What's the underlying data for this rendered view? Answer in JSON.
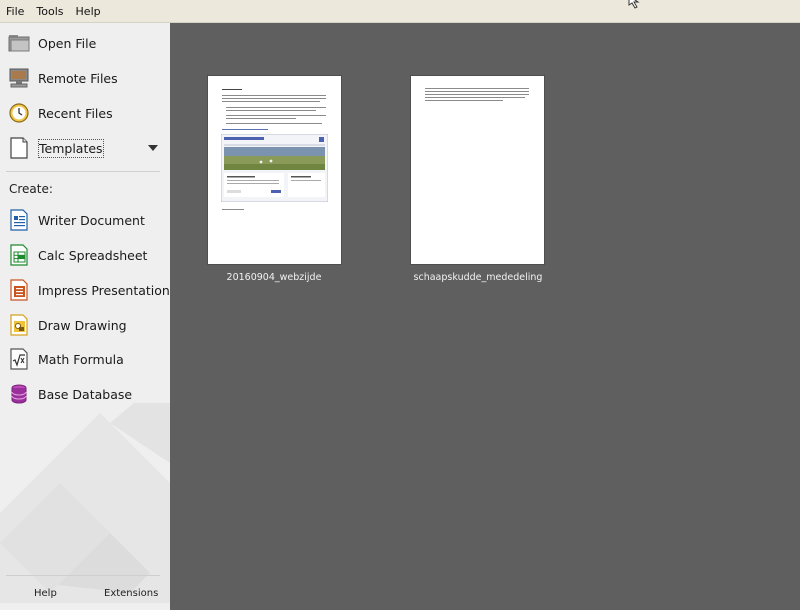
{
  "menubar": {
    "items": [
      {
        "label": "File"
      },
      {
        "label": "Tools"
      },
      {
        "label": "Help"
      }
    ]
  },
  "sidebar": {
    "open_file": {
      "label": "Open File",
      "icon": "folder-icon"
    },
    "remote_files": {
      "label": "Remote Files",
      "icon": "remote-computer-icon"
    },
    "recent_files": {
      "label": "Recent Files",
      "icon": "clock-icon"
    },
    "templates": {
      "label": "Templates",
      "icon": "template-page-icon"
    },
    "create_label": "Create:",
    "create_items": [
      {
        "label": "Writer Document",
        "icon": "writer-icon",
        "color": "#1f5fa8"
      },
      {
        "label": "Calc Spreadsheet",
        "icon": "calc-icon",
        "color": "#1e8a2f"
      },
      {
        "label": "Impress Presentation",
        "icon": "impress-icon",
        "color": "#c8541e"
      },
      {
        "label": "Draw Drawing",
        "icon": "draw-icon",
        "color": "#d6a21a"
      },
      {
        "label": "Math Formula",
        "icon": "math-icon",
        "color": "#555555"
      },
      {
        "label": "Base Database",
        "icon": "base-icon",
        "color": "#9b2f9b"
      }
    ],
    "footer": {
      "help_label": "Help",
      "extensions_label": "Extensions"
    }
  },
  "recent_documents": [
    {
      "name": "20160904_webzijde"
    },
    {
      "name": "schaapskudde_mededeling"
    }
  ],
  "colors": {
    "main_background": "#5f5f5f",
    "sidebar_background": "#efefef",
    "menubar_background": "#ece8dc"
  }
}
